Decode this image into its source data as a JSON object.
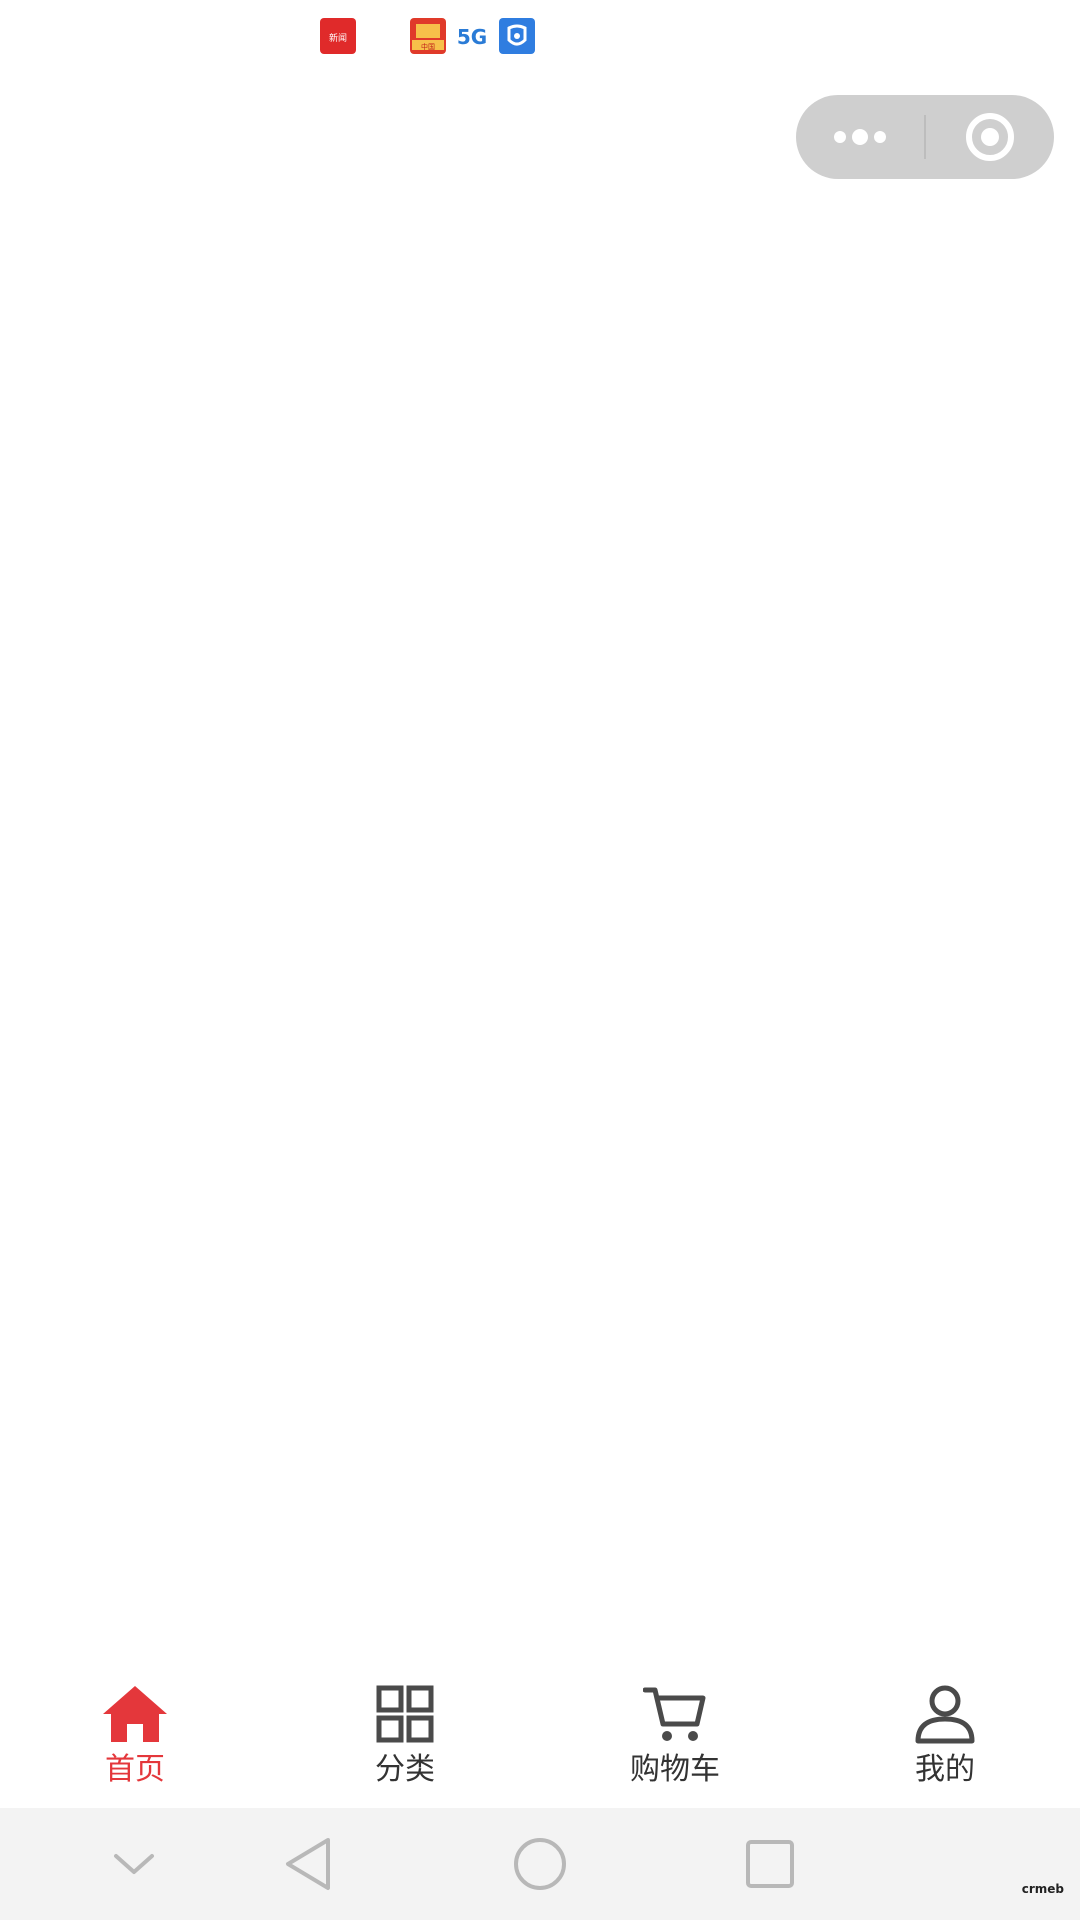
{
  "status_bar": {
    "icons": [
      "news-app-icon",
      "red-app-icon",
      "5g-icon",
      "blue-app-icon"
    ],
    "news_icon_text": "新闻",
    "red_icon_text": "中国",
    "fiveg_text": "5G"
  },
  "capsule": {
    "more_icon": "more-dots-icon",
    "close_icon": "target-circle-icon"
  },
  "tabbar": {
    "active_color": "#e4373b",
    "inactive_color": "#333333",
    "tabs": [
      {
        "label": "首页",
        "icon": "home-icon",
        "active": true
      },
      {
        "label": "分类",
        "icon": "grid-icon",
        "active": false
      },
      {
        "label": "购物车",
        "icon": "cart-icon",
        "active": false
      },
      {
        "label": "我的",
        "icon": "user-icon",
        "active": false
      }
    ]
  },
  "sysnav": {
    "buttons": [
      "chevron-down-icon",
      "back-triangle-icon",
      "home-circle-icon",
      "recents-square-icon"
    ],
    "watermark": "crmeb"
  }
}
